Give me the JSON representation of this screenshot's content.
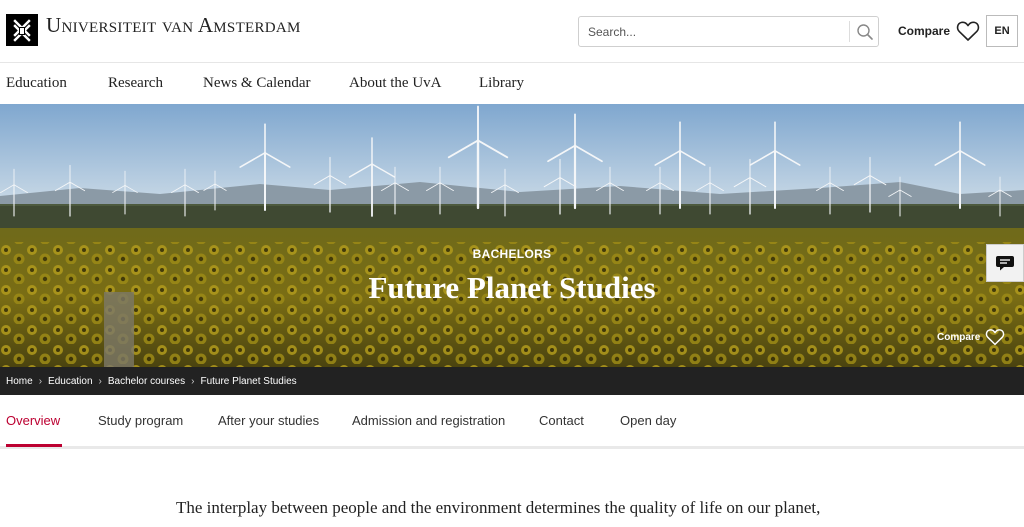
{
  "brand": {
    "name": "Universiteit van Amsterdam"
  },
  "search": {
    "placeholder": "Search..."
  },
  "header": {
    "compare_label": "Compare",
    "lang_label": "EN"
  },
  "main_nav": {
    "items": [
      "Education",
      "Research",
      "News & Calendar",
      "About the UvA",
      "Library"
    ]
  },
  "hero": {
    "kicker": "BACHELORS",
    "title": "Future Planet Studies",
    "compare_label": "Compare"
  },
  "breadcrumb": [
    "Home",
    "Education",
    "Bachelor courses",
    "Future Planet Studies"
  ],
  "tabs": {
    "items": [
      "Overview",
      "Study program",
      "After your studies",
      "Admission and registration",
      "Contact",
      "Open day"
    ],
    "active": "Overview"
  },
  "intro": {
    "text": "The interplay between people and the environment determines the quality of life on our planet,"
  },
  "colors": {
    "accent": "#bc0031",
    "breadcrumb_bg": "#222222"
  },
  "icons": {
    "search": "search-icon",
    "compare": "heart-icon",
    "chat": "chat-icon",
    "logo": "uva-crest-icon"
  }
}
